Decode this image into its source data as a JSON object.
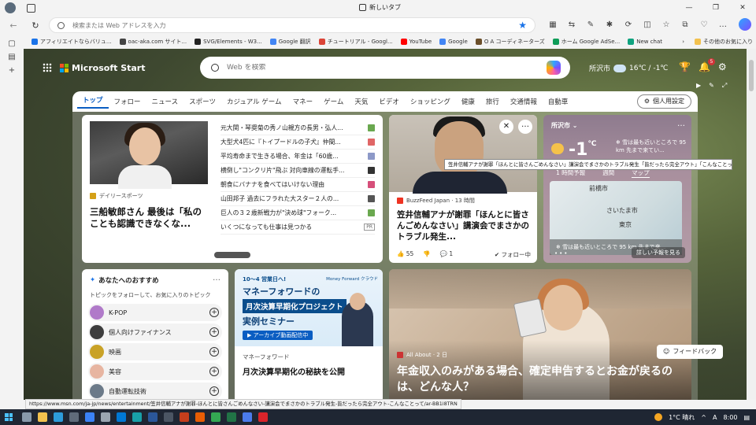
{
  "browser": {
    "tab_title": "新しいタブ",
    "address_placeholder": "検索または Web アドレスを入力",
    "bookmarks": [
      {
        "label": "アフィリエイトならバリュ...",
        "color": "#1a73e8"
      },
      {
        "label": "oac-aka.com サイト...",
        "color": "#444444"
      },
      {
        "label": "SVG/Elements - W3...",
        "color": "#222222"
      },
      {
        "label": "Google 翻訳",
        "color": "#4285f4"
      },
      {
        "label": "チュートリアル - Googl...",
        "color": "#db4437"
      },
      {
        "label": "YouTube",
        "color": "#ff0000"
      },
      {
        "label": "Google",
        "color": "#4285f4"
      },
      {
        "label": "O A コーディネーターズ",
        "color": "#6b4f2a"
      },
      {
        "label": "ホーム Google AdSe...",
        "color": "#0f9d58"
      },
      {
        "label": "New chat",
        "color": "#10a37f"
      }
    ],
    "bookmarks_more": "その他のお気に入り",
    "status_url": "https://www.msn.com/ja-jp/news/entertainment/笠井信輔アナが謝罪-ほんとに皆さんごめんなさい-講演会でまさかのトラブル発生-皆だったら完全アウト-こんなことって/ar-BB1i8TRN"
  },
  "header": {
    "logo": "Microsoft Start",
    "search_placeholder": "Web を検索",
    "weather_city": "所沢市",
    "weather_temp": "16℃ / -1℃",
    "notification_count": "5"
  },
  "nav": {
    "items": [
      "トップ",
      "フォロー",
      "ニュース",
      "スポーツ",
      "カジュアル ゲーム",
      "マネー",
      "ゲーム",
      "天気",
      "ビデオ",
      "ショッピング",
      "健康",
      "旅行",
      "交通情報",
      "自動車"
    ],
    "personal": "個人用設定"
  },
  "card_main": {
    "source": "デイリースポーツ",
    "headline": "三船敏郎さん 最後は「私のことも認識できなくな...",
    "list": [
      "元大関・琴奨菊の秀ノ山親方の長男・弘人...",
      "大型犬4匹に『トイプードルの子犬』仲間...",
      "平均寿命まで生きる場合、年金は「60歳...",
      "横倒し\"コンクリ片\"飛ぶ 対向車線の運転手...",
      "朝食にバナナを食べてはいけない理由",
      "山田邦子 過去にフラれた大スター２人の...",
      "巨人の３２歳新戦力が\"決め球\"フォーク...",
      "いくつになっても仕事は見つかる"
    ],
    "list_badge": "PR"
  },
  "card_news": {
    "source": "BuzzFeed Japan · 13 時間",
    "headline": "笠井信輔アナが謝罪「ほんとに皆さんごめんなさい」講演会でまさかのトラブル発生...",
    "likes": "55",
    "comments": "1",
    "follow": "フォロー中"
  },
  "tooltip": "笠井信輔アナが謝罪「ほんとに皆さんごめんなさい」講演会でまさかのトラブル発生「皆だったら完全アウト」「こんなことって...",
  "card_weather": {
    "city": "所沢市",
    "temp": "-1",
    "unit": "℃",
    "alert": "雪は最も近いところで 95 km 先まで来てい...",
    "tabs": [
      "1 時間予報",
      "週間",
      "マップ"
    ],
    "map_city1": "さいたま市",
    "map_city2": "東京",
    "map_city3": "前橋市",
    "map_band": "雪は最も近いところで 95 km 先まで来...",
    "detail": "詳しい予報を見る"
  },
  "card_topics": {
    "title": "あなたへのおすすめ",
    "hint": "トピックをフォローして、お気に入りのトピック",
    "topics": [
      {
        "label": "K-POP",
        "color": "#b07ac9"
      },
      {
        "label": "個人向けファイナンス",
        "color": "#3d3d3d"
      },
      {
        "label": "映画",
        "color": "#c9a227"
      },
      {
        "label": "美容",
        "color": "#e7b5a1"
      },
      {
        "label": "自動運転技術",
        "color": "#6c7a89"
      }
    ]
  },
  "card_ad": {
    "line1": "10～4 営業日へ!",
    "brand": "Money Forward クラウド",
    "line2": "マネーフォワードの",
    "line3": "月次決算早期化プロジェクト",
    "line4": "実例セミナー",
    "line5": "アーカイブ動画配信中",
    "source": "マネーフォワード",
    "headline": "月次決算早期化の秘訣を公開"
  },
  "card_big": {
    "source": "All About · 2 日",
    "headline": "年金収入のみがある場合、確定申告するとお金が戻るのは、どんな人？"
  },
  "feedback": "フィードバック",
  "taskbar": {
    "weather": "1°C 晴れ",
    "ime": "A",
    "time": "8:00"
  }
}
